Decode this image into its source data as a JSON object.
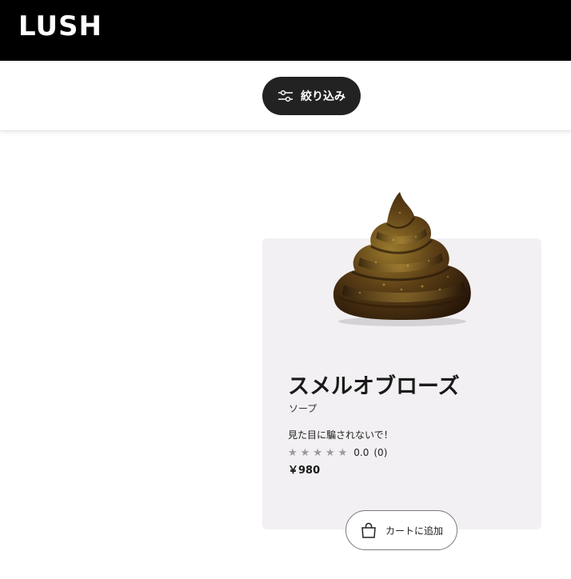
{
  "header": {
    "logo_text": "LUSH"
  },
  "toolbar": {
    "filter_label": "絞り込み",
    "filter_icon": "sliders-icon"
  },
  "product": {
    "name": "スメルオブローズ",
    "category": "ソープ",
    "tagline": "見た目に騙されないで！",
    "rating": {
      "stars_total": 5,
      "score": "0.0",
      "count": "(0)"
    },
    "price": "￥980",
    "image_icon": "swirl-soap-image",
    "add_to_cart_label": "カートに追加",
    "cart_icon": "shopping-bag-icon"
  },
  "colors": {
    "header_bg": "#000000",
    "filter_button_bg": "#222222",
    "card_bg": "#f2f0f2",
    "star_empty": "#9a9a9a"
  }
}
